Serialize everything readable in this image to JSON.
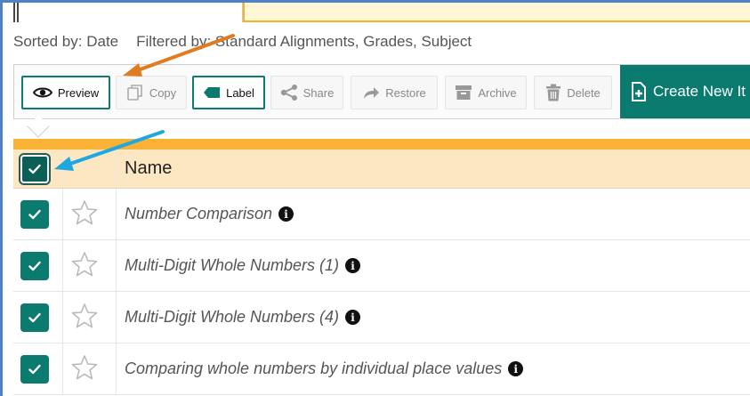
{
  "sortbar": {
    "sorted": "Sorted by: Date",
    "filtered": "Filtered by: Standard Alignments, Grades, Subject"
  },
  "toolbar": {
    "preview": "Preview",
    "copy": "Copy",
    "label": "Label",
    "share": "Share",
    "restore": "Restore",
    "archive": "Archive",
    "delete": "Delete",
    "create_new": "Create New It"
  },
  "table": {
    "header_name": "Name",
    "select_all_checked": true,
    "rows": [
      {
        "name": "Number Comparison",
        "checked": true,
        "starred": false
      },
      {
        "name": "Multi-Digit Whole Numbers (1)",
        "checked": true,
        "starred": false
      },
      {
        "name": "Multi-Digit Whole Numbers (4)",
        "checked": true,
        "starred": false
      },
      {
        "name": "Comparing whole numbers by individual place values",
        "checked": true,
        "starred": false
      }
    ]
  },
  "annotations": {
    "arrow_orange_color": "#e07b1f",
    "arrow_blue_color": "#1ea7e1"
  },
  "colors": {
    "accent": "#0b7a6f",
    "header_bar": "#f9b233",
    "header_bg": "#fde7c3",
    "frame": "#4f81c7"
  }
}
